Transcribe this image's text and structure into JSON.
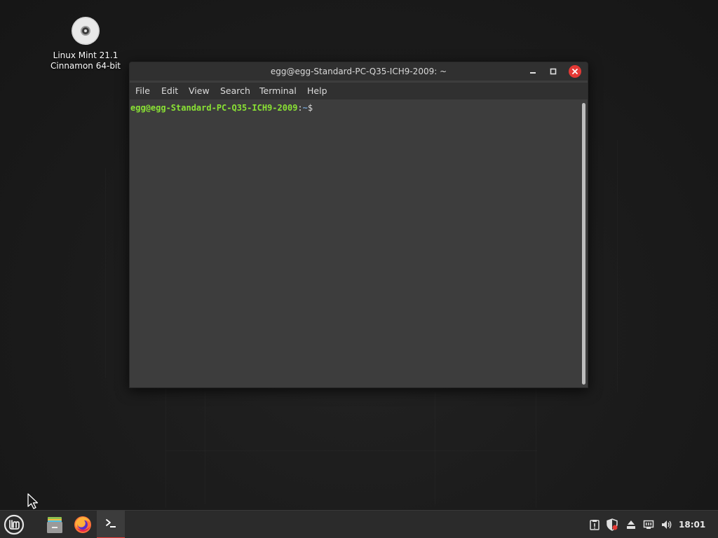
{
  "desktop": {
    "icon": {
      "label_line1": "Linux Mint 21.1",
      "label_line2": "Cinnamon 64-bit",
      "icon_name": "disc-icon"
    }
  },
  "terminal": {
    "title": "egg@egg-Standard-PC-Q35-ICH9-2009: ~",
    "menu": [
      "File",
      "Edit",
      "View",
      "Search",
      "Terminal",
      "Help"
    ],
    "prompt_user": "egg@egg-Standard-PC-Q35-ICH9-2009",
    "prompt_sep": ":",
    "prompt_path": "~",
    "prompt_symbol": "$",
    "window_buttons": [
      "minimize-icon",
      "maximize-icon",
      "close-icon"
    ],
    "close_color": "#e53935",
    "prompt_user_color": "#8ae234",
    "prompt_path_color": "#729fcf"
  },
  "taskbar": {
    "launchers": [
      "mint-menu-icon",
      "files-icon",
      "firefox-icon",
      "terminal-icon"
    ],
    "active_indicator_color": "#e53935",
    "tray": [
      "update-manager-icon",
      "shield-icon",
      "removable-drive-icon",
      "network-icon",
      "volume-icon"
    ],
    "clock": "18:01"
  }
}
